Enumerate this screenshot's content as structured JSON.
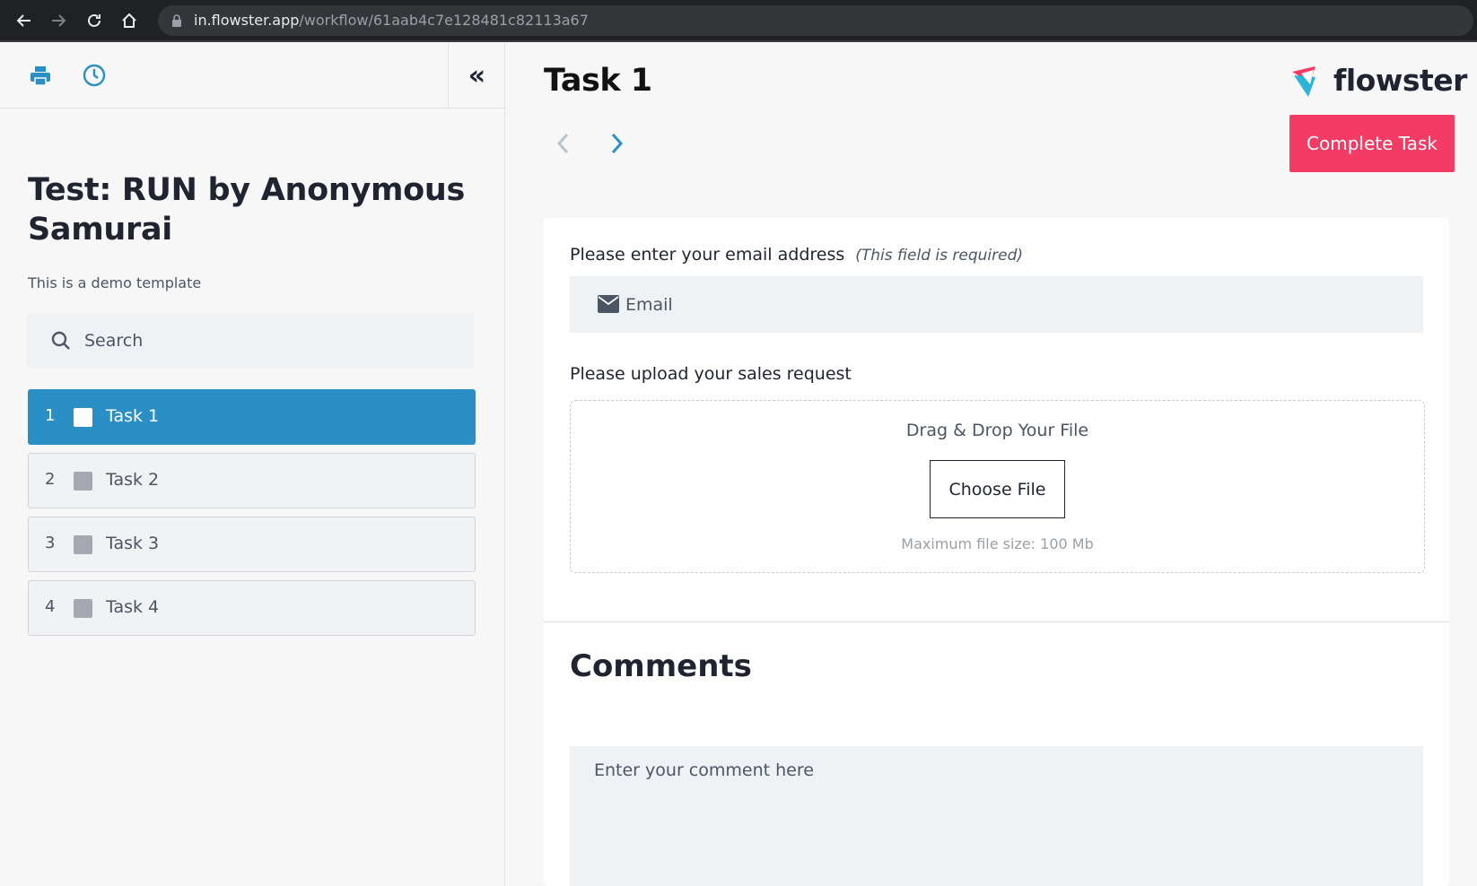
{
  "browser": {
    "url_host": "in.flowster.app",
    "url_path": "/workflow/61aab4c7e128481c82113a67"
  },
  "sidebar": {
    "workflow_title": "Test: RUN by Anonymous Samurai",
    "description": "This is a demo template",
    "search_placeholder": "Search",
    "tasks": [
      {
        "number": "1",
        "label": "Task 1",
        "active": true
      },
      {
        "number": "2",
        "label": "Task 2",
        "active": false
      },
      {
        "number": "3",
        "label": "Task 3",
        "active": false
      },
      {
        "number": "4",
        "label": "Task 4",
        "active": false
      }
    ],
    "collapse_glyph": "«"
  },
  "main": {
    "task_title": "Task 1",
    "logo_text": "flowster",
    "complete_label": "Complete Task",
    "email_label": "Please enter your email address",
    "email_required": "(This field is required)",
    "email_placeholder": "Email",
    "upload_label": "Please upload your sales request",
    "drop_title": "Drag & Drop Your File",
    "choose_label": "Choose File",
    "max_size": "Maximum file size: 100 Mb",
    "comments_title": "Comments",
    "comment_placeholder": "Enter your comment here"
  },
  "colors": {
    "accent": "#2a8fc4",
    "complete": "#f33b63"
  }
}
